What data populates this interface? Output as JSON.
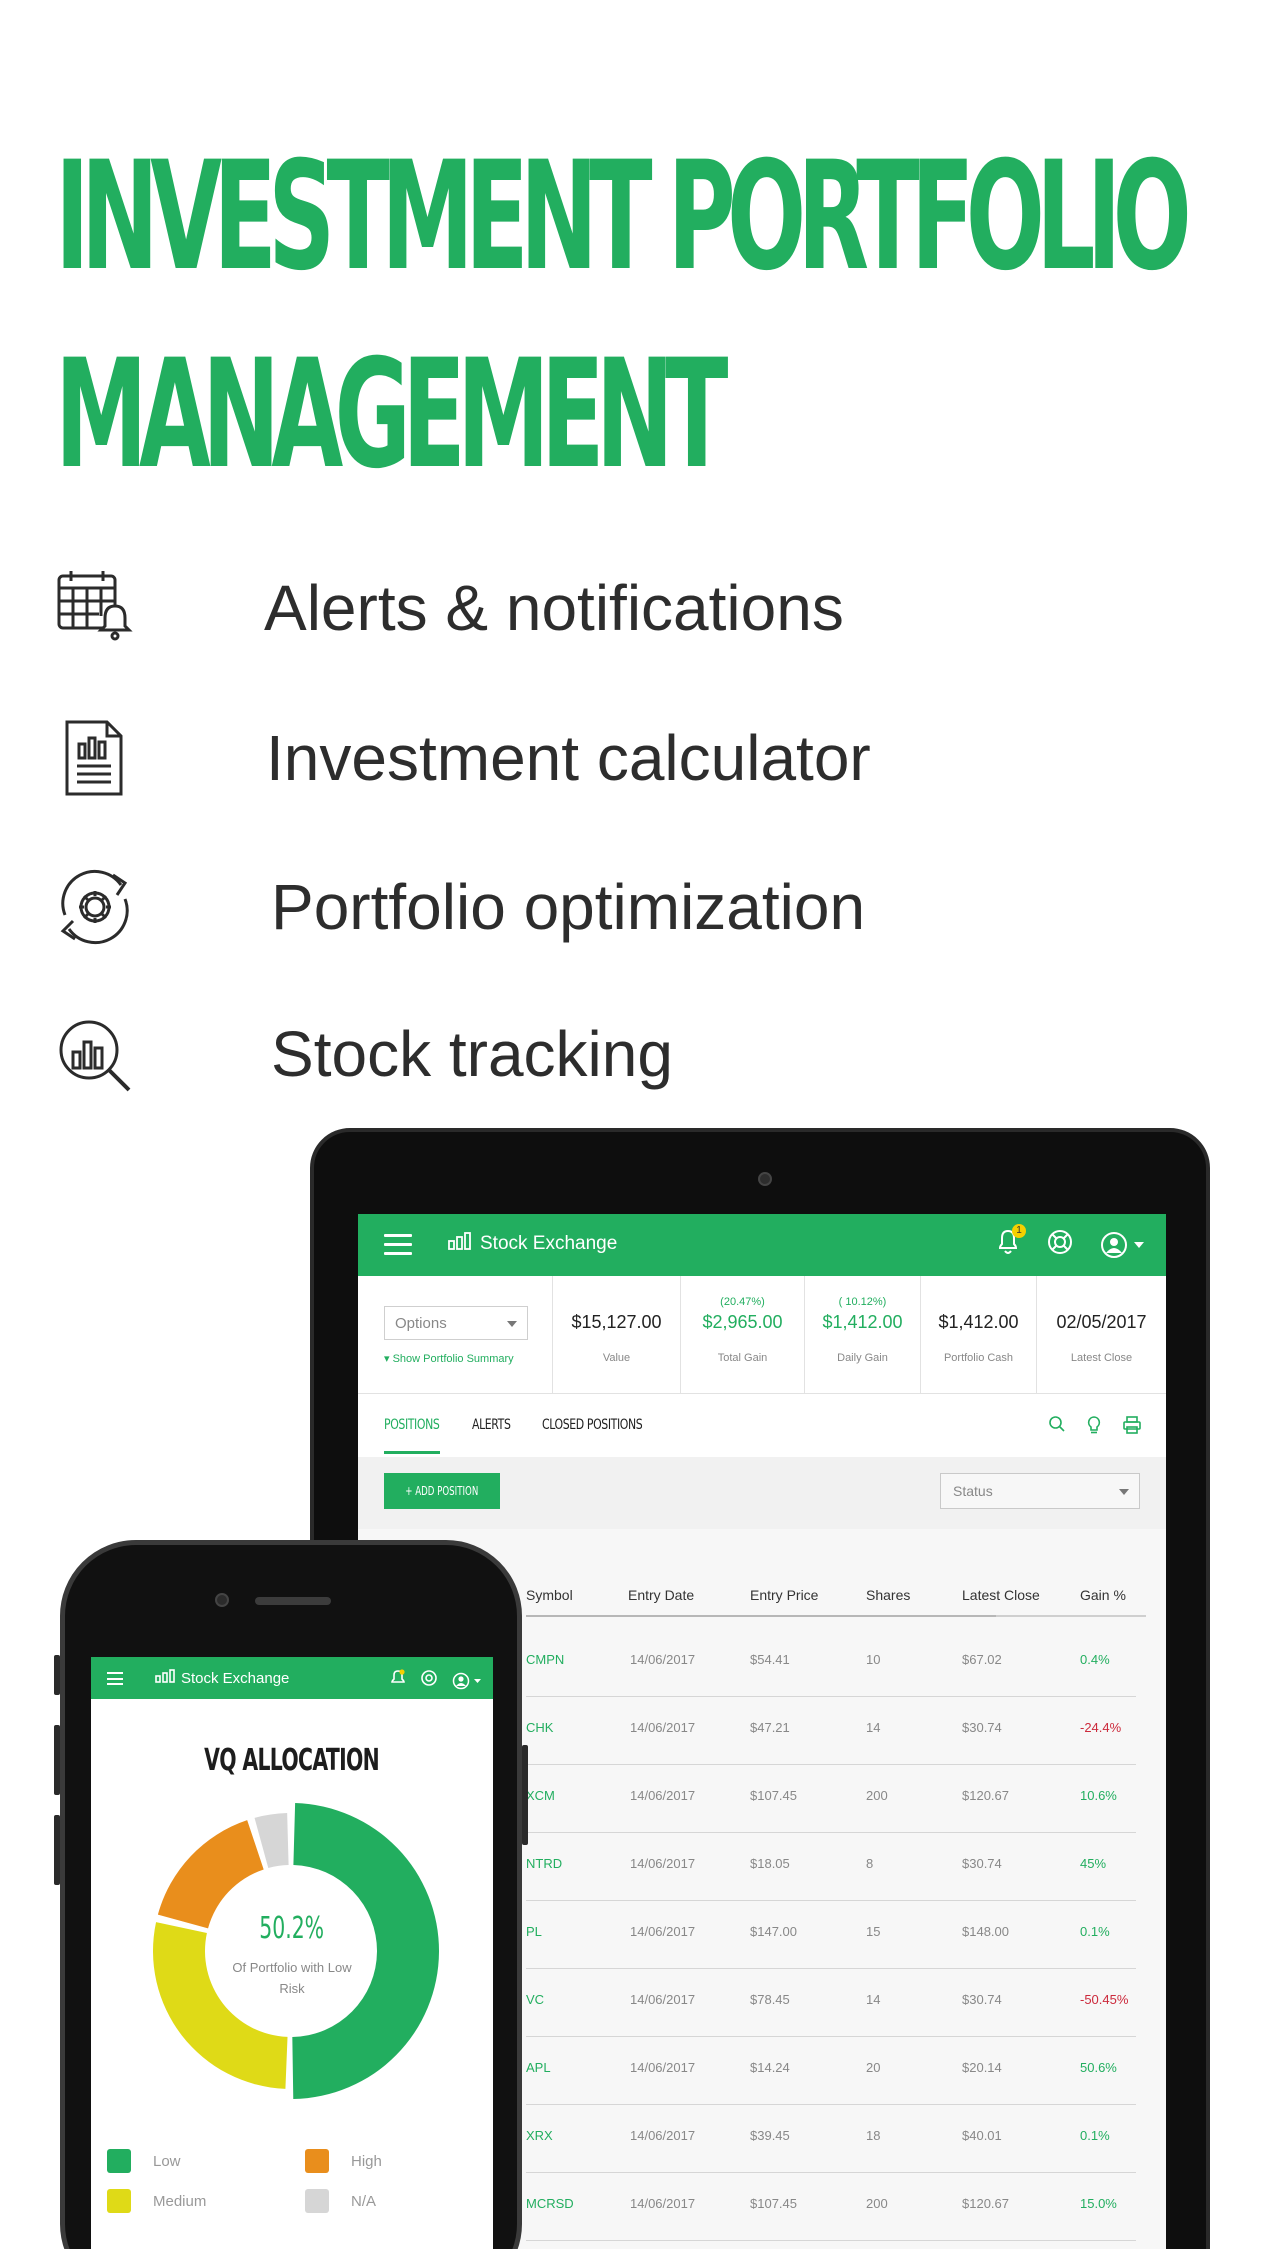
{
  "hero": {
    "title_line1": "INVESTMENT PORTFOLIO",
    "title_line2": "MANAGEMENT"
  },
  "features": [
    {
      "icon": "calendar-bell-icon",
      "label": "Alerts & notifications"
    },
    {
      "icon": "document-chart-icon",
      "label": "Investment calculator"
    },
    {
      "icon": "gear-cycle-icon",
      "label": "Portfolio optimization"
    },
    {
      "icon": "chart-magnifier-icon",
      "label": "Stock tracking"
    }
  ],
  "colors": {
    "brand_green": "#22ae5f",
    "negative_red": "#cc2a3c",
    "alloc_low": "#22ae5f",
    "alloc_high": "#e98e1c",
    "alloc_medium": "#dfda17",
    "alloc_na": "#d6d6d6"
  },
  "tablet": {
    "app_name": "Stock Exchange",
    "notification_count": "1",
    "options_select": "Options",
    "show_summary_link": "Show Portfolio Summary",
    "metrics": [
      {
        "pct": "",
        "value": "$15,127.00",
        "label": "Value",
        "green": false
      },
      {
        "pct": "(20.47%)",
        "value": "$2,965.00",
        "label": "Total Gain",
        "green": true
      },
      {
        "pct": "( 10.12%)",
        "value": "$1,412.00",
        "label": "Daily Gain",
        "green": true
      },
      {
        "pct": "",
        "value": "$1,412.00",
        "label": "Portfolio Cash",
        "green": false
      },
      {
        "pct": "",
        "value": "02/05/2017",
        "label": "Latest Close",
        "green": false
      }
    ],
    "tabs": [
      {
        "label": "Positions",
        "active": true
      },
      {
        "label": "Alerts",
        "active": false
      },
      {
        "label": "Closed Positions",
        "active": false
      }
    ],
    "add_position_label": "+ ADD POSITION",
    "status_select": "Status",
    "table": {
      "columns": [
        "Symbol",
        "Entry Date",
        "Entry Price",
        "Shares",
        "Latest Close",
        "Gain %"
      ],
      "rows": [
        {
          "symbol": "CMPN",
          "entry_date": "14/06/2017",
          "entry_price": "$54.41",
          "shares": "10",
          "latest_close": "$67.02",
          "gain": "0.4%",
          "negative": false
        },
        {
          "symbol": "CHK",
          "entry_date": "14/06/2017",
          "entry_price": "$47.21",
          "shares": "14",
          "latest_close": "$30.74",
          "gain": "-24.4%",
          "negative": true
        },
        {
          "symbol": "XCM",
          "entry_date": "14/06/2017",
          "entry_price": "$107.45",
          "shares": "200",
          "latest_close": "$120.67",
          "gain": "10.6%",
          "negative": false
        },
        {
          "symbol": "NTRD",
          "entry_date": "14/06/2017",
          "entry_price": "$18.05",
          "shares": "8",
          "latest_close": "$30.74",
          "gain": "45%",
          "negative": false
        },
        {
          "symbol": "PL",
          "entry_date": "14/06/2017",
          "entry_price": "$147.00",
          "shares": "15",
          "latest_close": "$148.00",
          "gain": "0.1%",
          "negative": false
        },
        {
          "symbol": "VC",
          "entry_date": "14/06/2017",
          "entry_price": "$78.45",
          "shares": "14",
          "latest_close": "$30.74",
          "gain": "-50.45%",
          "negative": true
        },
        {
          "symbol": "APL",
          "entry_date": "14/06/2017",
          "entry_price": "$14.24",
          "shares": "20",
          "latest_close": "$20.14",
          "gain": "50.6%",
          "negative": false
        },
        {
          "symbol": "XRX",
          "entry_date": "14/06/2017",
          "entry_price": "$39.45",
          "shares": "18",
          "latest_close": "$40.01",
          "gain": "0.1%",
          "negative": false
        },
        {
          "symbol": "MCRSD",
          "entry_date": "14/06/2017",
          "entry_price": "$107.45",
          "shares": "200",
          "latest_close": "$120.67",
          "gain": "15.0%",
          "negative": false
        }
      ]
    }
  },
  "phone": {
    "app_name": "Stock Exchange",
    "title": "VQ ALLOCATION",
    "center_value": "50.2%",
    "center_caption": "Of Portfolio with Low Risk",
    "allocation": [
      {
        "name": "Low",
        "percent": 50.2,
        "color": "#22ae5f"
      },
      {
        "name": "Medium",
        "percent": 28.6,
        "color": "#dfda17"
      },
      {
        "name": "High",
        "percent": 16.5,
        "color": "#e98e1c"
      },
      {
        "name": "N/A",
        "percent": 4.7,
        "color": "#d6d6d6"
      }
    ],
    "legend": [
      {
        "name": "Low",
        "color": "#22ae5f"
      },
      {
        "name": "High",
        "color": "#e98e1c"
      },
      {
        "name": "Medium",
        "color": "#dfda17"
      },
      {
        "name": "N/A",
        "color": "#d6d6d6"
      }
    ]
  }
}
